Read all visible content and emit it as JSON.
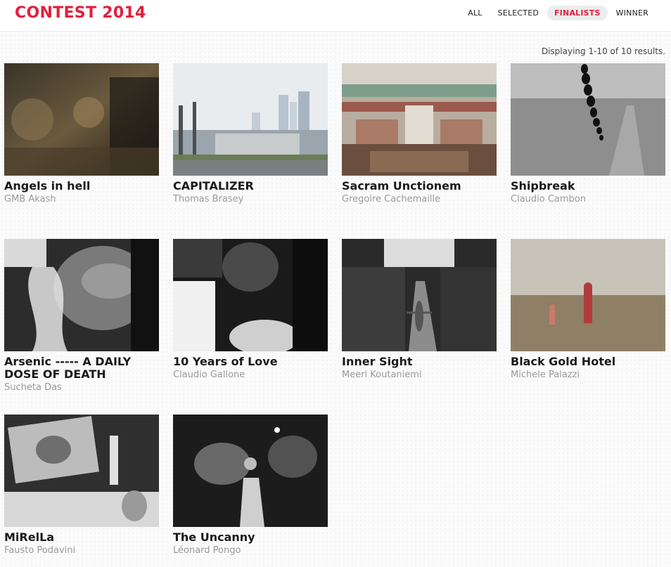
{
  "header": {
    "logo": "CONTEST 2014",
    "nav": [
      {
        "label": "ALL",
        "active": false
      },
      {
        "label": "SELECTED",
        "active": false
      },
      {
        "label": "FINALISTS",
        "active": true
      },
      {
        "label": "WINNER",
        "active": false
      }
    ]
  },
  "results_text": "Displaying 1-10 of 10 results.",
  "entries": [
    {
      "title": "Angels in hell",
      "author": "GMB Akash"
    },
    {
      "title": "CAPITALIZER",
      "author": "Thomas Brasey"
    },
    {
      "title": "Sacram Unctionem",
      "author": "Gregoire Cachemaille"
    },
    {
      "title": "Shipbreak",
      "author": "Claudio Cambon"
    },
    {
      "title": "Arsenic ----- A DAILY DOSE OF DEATH",
      "author": "Sucheta Das"
    },
    {
      "title": "10 Years of Love",
      "author": "Claudio Gallone"
    },
    {
      "title": "Inner Sight",
      "author": "Meeri Koutaniemi"
    },
    {
      "title": "Black Gold Hotel",
      "author": "Michele Palazzi"
    },
    {
      "title": "MiRelLa",
      "author": "Fausto Podavini"
    },
    {
      "title": "The Uncanny",
      "author": "Léonard Pongo"
    }
  ],
  "colors": {
    "accent": "#e0203c",
    "title": "#1a1a1a",
    "author": "#9a9a9a"
  }
}
